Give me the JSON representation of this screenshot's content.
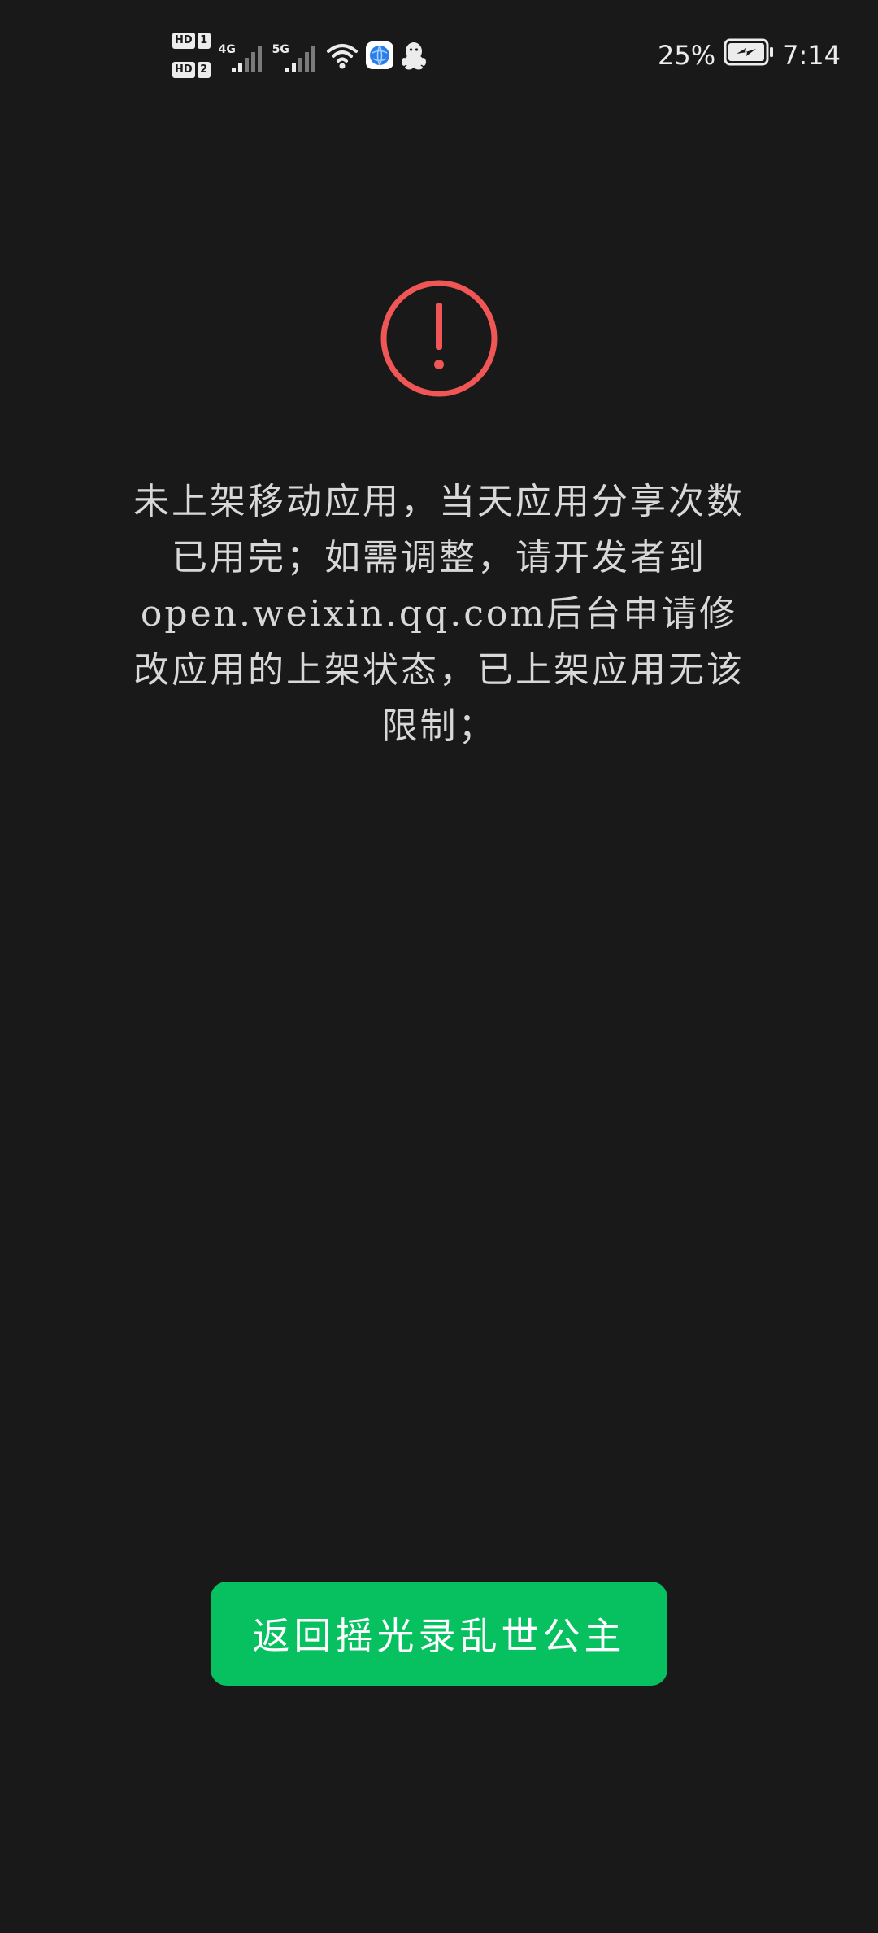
{
  "status_bar": {
    "sim1_badge": "HD",
    "sim1_slot": "1",
    "sim2_badge": "HD",
    "sim2_slot": "2",
    "network1": "4G",
    "network2": "5G",
    "icons": [
      "signal-icon",
      "wifi-icon",
      "browser-app-icon",
      "qq-penguin-icon"
    ],
    "battery_percent": "25%",
    "battery_level": 25,
    "time": "7:14"
  },
  "error": {
    "icon": "exclamation-circle-icon",
    "icon_color": "#f15656",
    "message": "未上架移动应用，当天应用分享次数已用完；如需调整，请开发者到open.weixin.qq.com后台申请修改应用的上架状态，已上架应用无该限制；"
  },
  "actions": {
    "return_label": "返回摇光录乱世公主",
    "button_color": "#07c160"
  }
}
